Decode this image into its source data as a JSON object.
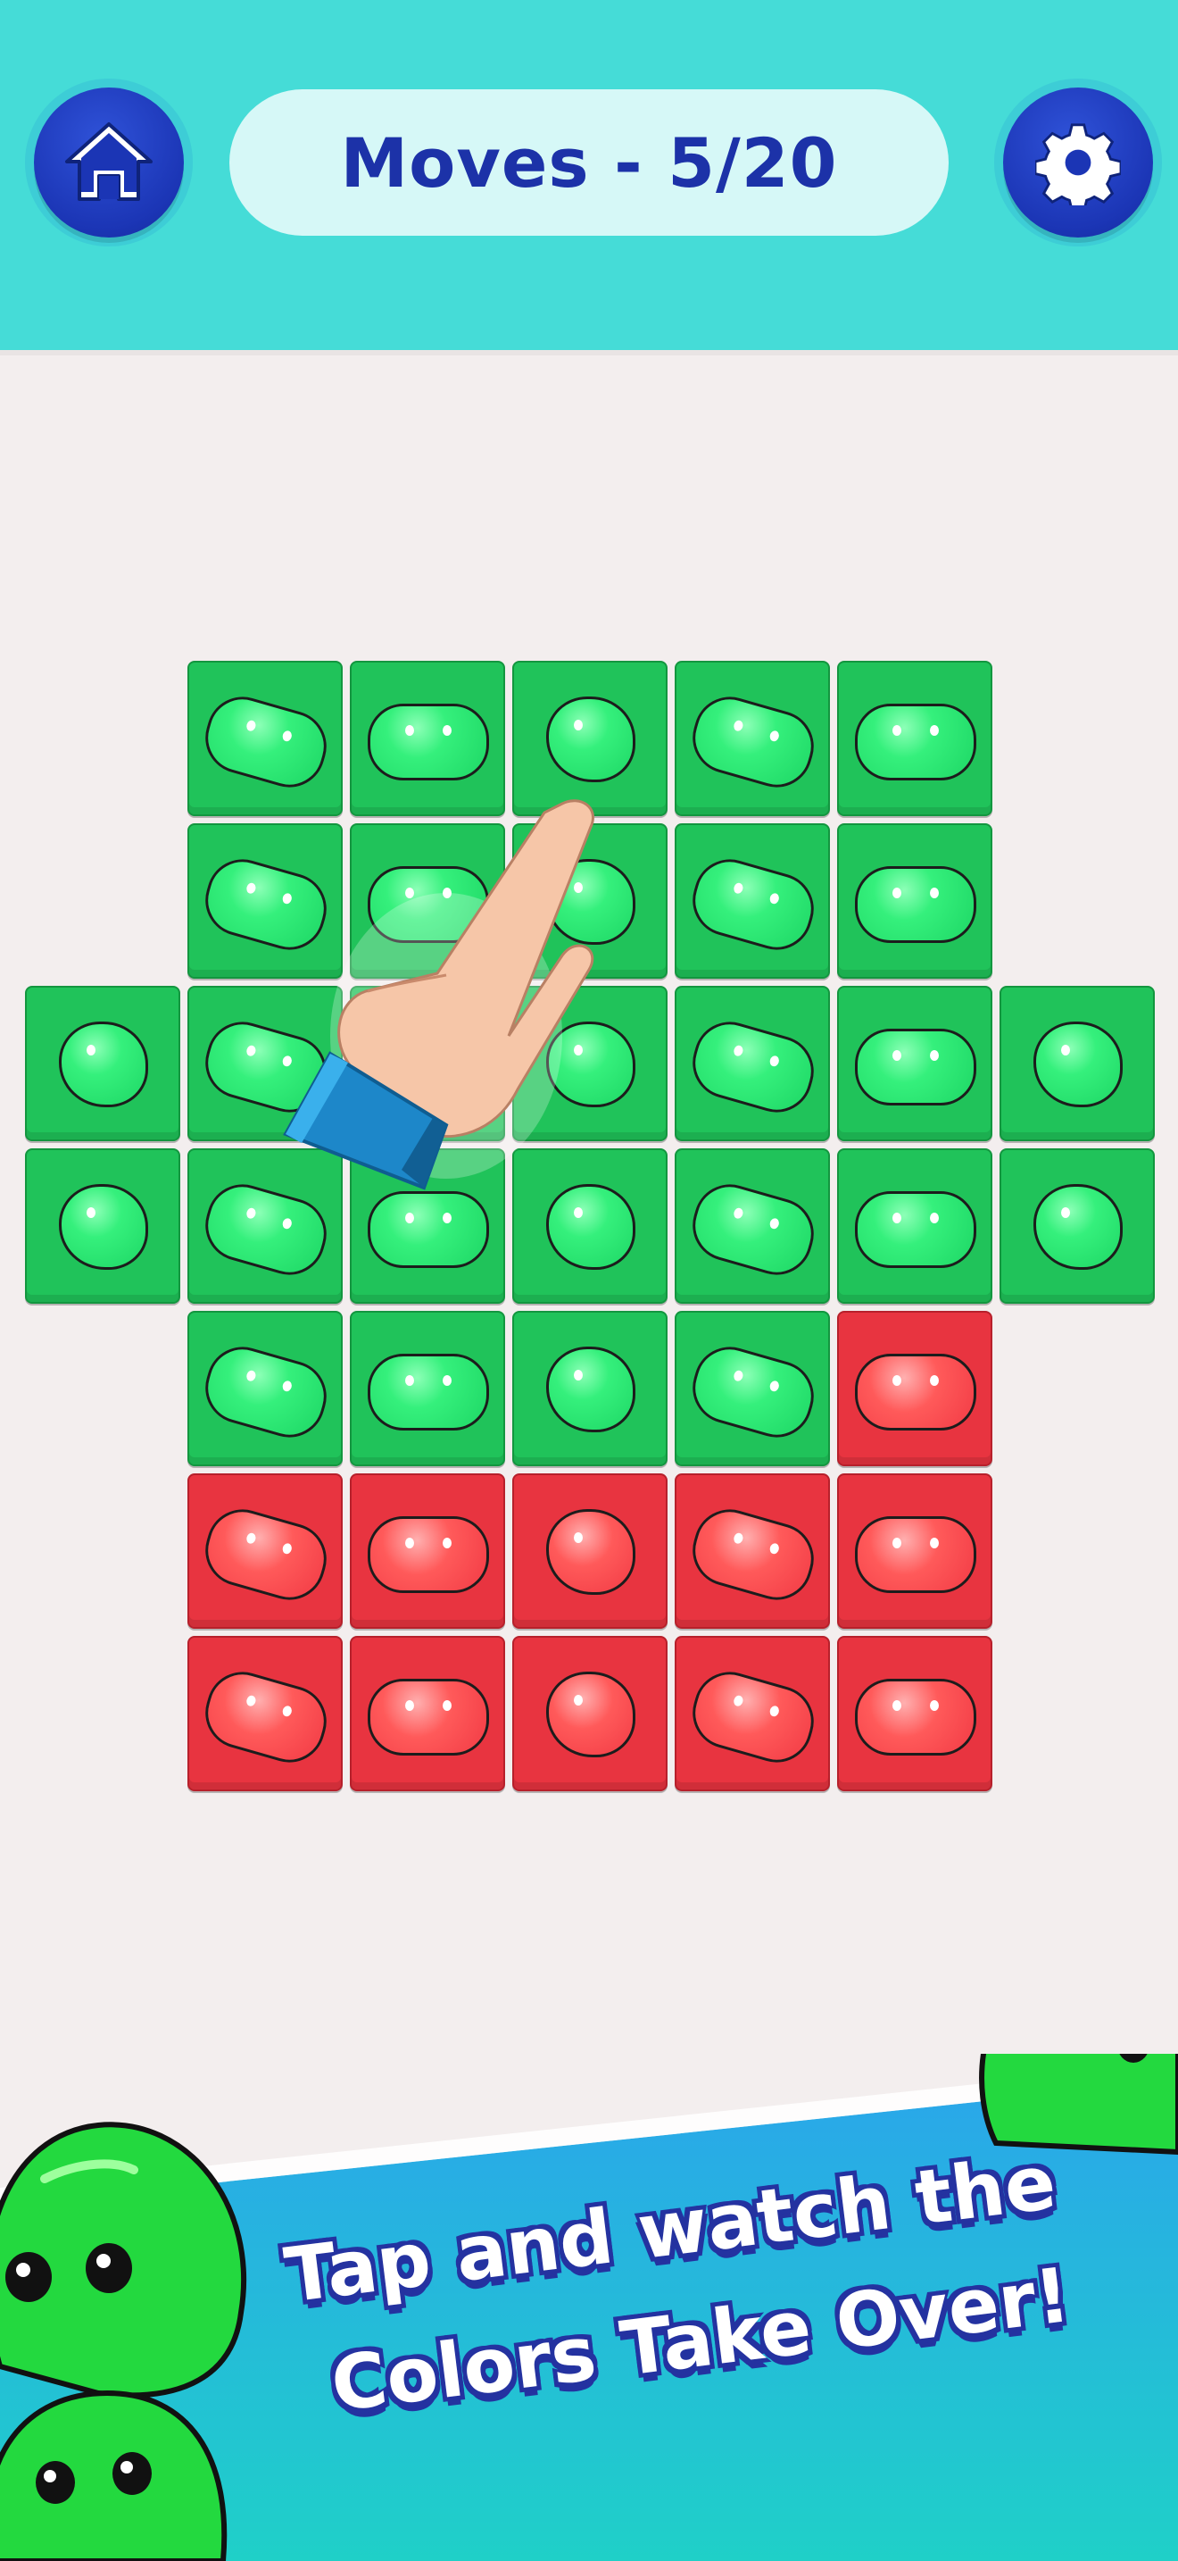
{
  "header": {
    "moves_label": "Moves - 5/20",
    "home_icon": "home-icon",
    "settings_icon": "gear-icon"
  },
  "board": {
    "colors": {
      "green": "#20c35a",
      "red": "#e83440"
    },
    "rows": [
      [
        "empty",
        "green",
        "green",
        "green",
        "green",
        "green",
        "empty"
      ],
      [
        "empty",
        "green",
        "green",
        "green",
        "green",
        "green",
        "empty"
      ],
      [
        "green",
        "green",
        "green",
        "green",
        "green",
        "green",
        "green"
      ],
      [
        "green",
        "green",
        "green",
        "green",
        "green",
        "green",
        "green"
      ],
      [
        "empty",
        "green",
        "green",
        "green",
        "green",
        "red",
        "empty"
      ],
      [
        "empty",
        "red",
        "red",
        "red",
        "red",
        "red",
        "empty"
      ],
      [
        "empty",
        "red",
        "red",
        "red",
        "red",
        "red",
        "empty"
      ]
    ]
  },
  "hint": {
    "icon": "pointing-hand-icon"
  },
  "banner": {
    "line1": "Tap and watch the",
    "line2": "Colors Take Over!",
    "accent": "#2ea8e6"
  }
}
